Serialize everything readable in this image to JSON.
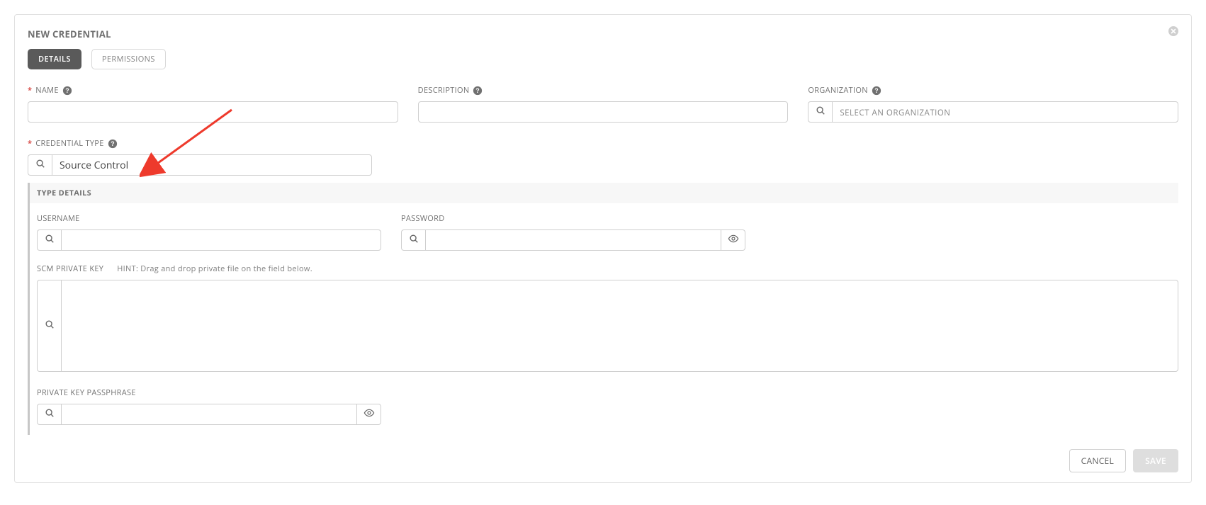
{
  "title": "NEW CREDENTIAL",
  "tabs": {
    "details": "DETAILS",
    "permissions": "PERMISSIONS"
  },
  "labels": {
    "name": "NAME",
    "description": "DESCRIPTION",
    "organization": "ORGANIZATION",
    "credential_type": "CREDENTIAL TYPE",
    "type_details": "TYPE DETAILS",
    "username": "USERNAME",
    "password": "PASSWORD",
    "scm_private_key": "SCM PRIVATE KEY",
    "scm_hint": "HINT: Drag and drop private file on the field below.",
    "passphrase": "PRIVATE KEY PASSPHRASE"
  },
  "values": {
    "name": "",
    "description": "",
    "organization": "",
    "organization_placeholder": "SELECT AN ORGANIZATION",
    "credential_type": "Source Control",
    "username": "",
    "password": "",
    "scm_private_key": "",
    "passphrase": ""
  },
  "buttons": {
    "cancel": "CANCEL",
    "save": "SAVE"
  }
}
